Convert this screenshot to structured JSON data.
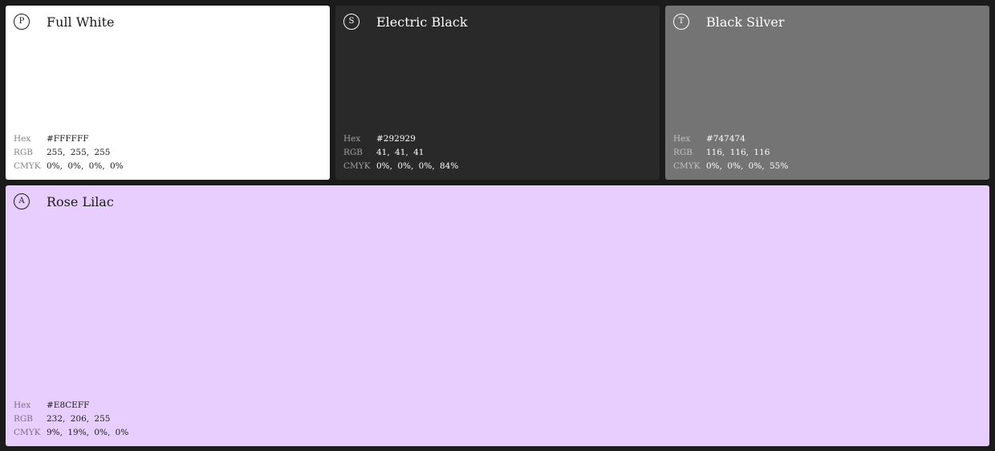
{
  "swatches": [
    {
      "badge": "P",
      "name": "Full White",
      "color": "#FFFFFF",
      "hex": "#FFFFFF",
      "rgb": "255, 255, 255",
      "cmyk": "0%, 0%, 0%, 0%"
    },
    {
      "badge": "S",
      "name": "Electric Black",
      "color": "#292929",
      "hex": "#292929",
      "rgb": "41, 41, 41",
      "cmyk": "0%, 0%, 0%, 84%"
    },
    {
      "badge": "T",
      "name": "Black Silver",
      "color": "#747474",
      "hex": "#747474",
      "rgb": "116, 116, 116",
      "cmyk": "0%, 0%, 0%, 55%"
    },
    {
      "badge": "A",
      "name": "Rose Lilac",
      "color": "#E8CEFF",
      "hex": "#E8CEFF",
      "rgb": "232, 206, 255",
      "cmyk": "9%, 19%, 0%, 0%"
    }
  ],
  "labels": {
    "hex": "Hex",
    "rgb": "RGB",
    "cmyk": "CMYK"
  }
}
